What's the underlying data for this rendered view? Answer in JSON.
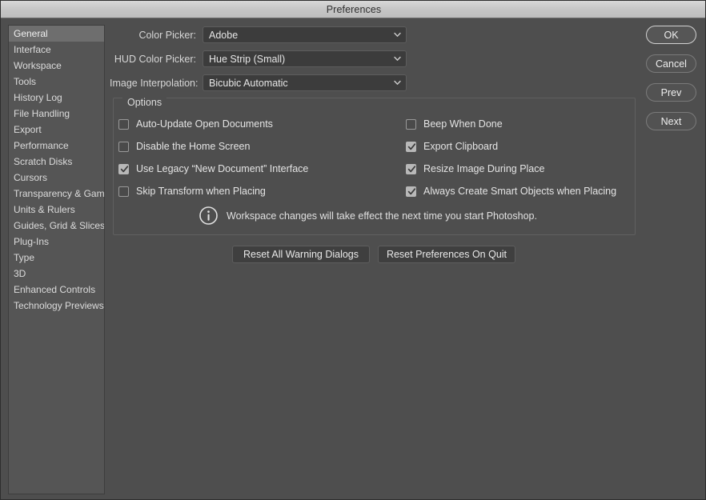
{
  "window": {
    "title": "Preferences"
  },
  "sidebar": {
    "items": [
      {
        "label": "General",
        "selected": true
      },
      {
        "label": "Interface",
        "selected": false
      },
      {
        "label": "Workspace",
        "selected": false
      },
      {
        "label": "Tools",
        "selected": false
      },
      {
        "label": "History Log",
        "selected": false
      },
      {
        "label": "File Handling",
        "selected": false
      },
      {
        "label": "Export",
        "selected": false
      },
      {
        "label": "Performance",
        "selected": false
      },
      {
        "label": "Scratch Disks",
        "selected": false
      },
      {
        "label": "Cursors",
        "selected": false
      },
      {
        "label": "Transparency & Gamut",
        "selected": false
      },
      {
        "label": "Units & Rulers",
        "selected": false
      },
      {
        "label": "Guides, Grid & Slices",
        "selected": false
      },
      {
        "label": "Plug-Ins",
        "selected": false
      },
      {
        "label": "Type",
        "selected": false
      },
      {
        "label": "3D",
        "selected": false
      },
      {
        "label": "Enhanced Controls",
        "selected": false
      },
      {
        "label": "Technology Previews",
        "selected": false
      }
    ]
  },
  "fields": [
    {
      "label": "Color Picker:",
      "value": "Adobe",
      "icon": "chevron-down-icon"
    },
    {
      "label": "HUD Color Picker:",
      "value": "Hue Strip (Small)",
      "icon": "chevron-down-icon"
    },
    {
      "label": "Image Interpolation:",
      "value": "Bicubic Automatic",
      "icon": "chevron-down-icon"
    }
  ],
  "options": {
    "legend": "Options",
    "left_column": [
      {
        "label": "Auto-Update Open Documents",
        "checked": false
      },
      {
        "label": "Disable the Home Screen",
        "checked": false
      },
      {
        "label": "Use Legacy “New Document” Interface",
        "checked": true
      },
      {
        "label": "Skip Transform when Placing",
        "checked": false
      }
    ],
    "right_column": [
      {
        "label": "Beep When Done",
        "checked": false
      },
      {
        "label": "Export Clipboard",
        "checked": true
      },
      {
        "label": "Resize Image During Place",
        "checked": true
      },
      {
        "label": "Always Create Smart Objects when Placing",
        "checked": true
      }
    ],
    "note": {
      "icon": "info-circle-icon",
      "text": "Workspace changes will take effect the next time you start Photoshop."
    }
  },
  "reset_buttons": [
    {
      "label": "Reset All Warning Dialogs"
    },
    {
      "label": "Reset Preferences On Quit"
    }
  ],
  "action_buttons": [
    {
      "label": "OK",
      "default": true
    },
    {
      "label": "Cancel",
      "default": false
    },
    {
      "label": "Prev",
      "default": false
    },
    {
      "label": "Next",
      "default": false
    }
  ],
  "colors": {
    "dialog_background": "#4e4e4e",
    "titlebar": "#c6c6c6",
    "list_background": "#555555",
    "selected_row": "#6e6e6e",
    "field_background": "#3c3c3c",
    "text": "#e4e4e4"
  }
}
